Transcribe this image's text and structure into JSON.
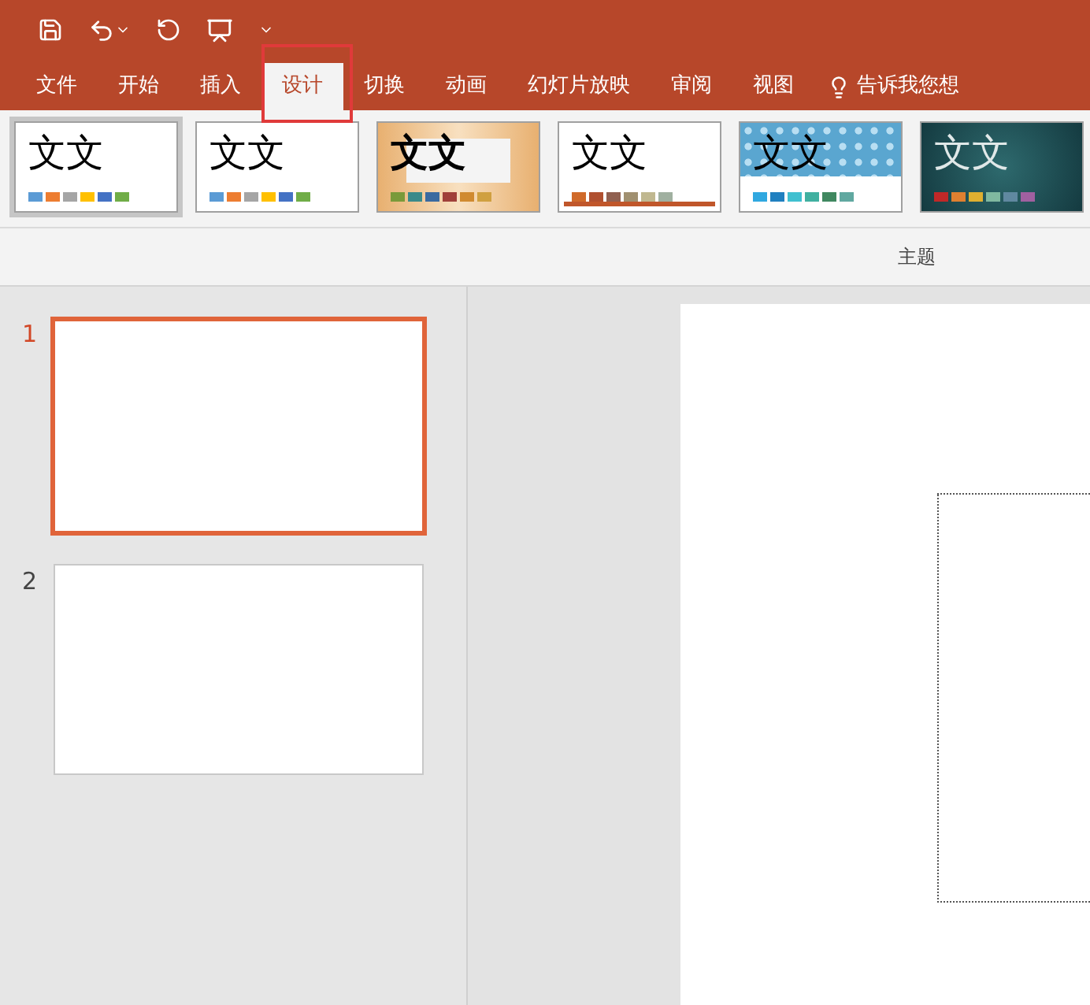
{
  "tabs": [
    {
      "label": "文件",
      "selected": false
    },
    {
      "label": "开始",
      "selected": false
    },
    {
      "label": "插入",
      "selected": false
    },
    {
      "label": "设计",
      "selected": true
    },
    {
      "label": "切换",
      "selected": false
    },
    {
      "label": "动画",
      "selected": false
    },
    {
      "label": "幻灯片放映",
      "selected": false
    },
    {
      "label": "审阅",
      "selected": false
    },
    {
      "label": "视图",
      "selected": false
    }
  ],
  "tell_me": "告诉我您想",
  "themes": [
    {
      "kind": "plain",
      "sample": "文文",
      "selected": true,
      "swatches": [
        {
          "color": "#5b9bd5"
        },
        {
          "color": "#ed7d31"
        },
        {
          "color": "#a5a5a5"
        },
        {
          "color": "#ffc000"
        },
        {
          "color": "#4472c4"
        },
        {
          "color": "#70ad47"
        }
      ]
    },
    {
      "kind": "plain",
      "sample": "文文",
      "selected": false,
      "swatches": [
        {
          "color": "#5b9bd5"
        },
        {
          "color": "#ed7d31"
        },
        {
          "color": "#a5a5a5"
        },
        {
          "color": "#ffc000"
        },
        {
          "color": "#4472c4"
        },
        {
          "color": "#70ad47"
        }
      ]
    },
    {
      "kind": "wood",
      "sample": "文文",
      "selected": false,
      "swatches": [
        {
          "color": "#7a9a3a"
        },
        {
          "color": "#3a8a8a"
        },
        {
          "color": "#3a6aa0"
        },
        {
          "color": "#a0403a"
        },
        {
          "color": "#d08a30"
        },
        {
          "color": "#d0a040"
        }
      ]
    },
    {
      "kind": "line",
      "sample": "文文",
      "selected": false,
      "swatches": [
        {
          "color": "#d06a2a"
        },
        {
          "color": "#b05030"
        },
        {
          "color": "#906050"
        },
        {
          "color": "#a09070"
        },
        {
          "color": "#c0b890"
        },
        {
          "color": "#a0b0a0"
        }
      ]
    },
    {
      "kind": "pattern",
      "sample": "文文",
      "selected": false,
      "swatches": [
        {
          "color": "#30a8e0"
        },
        {
          "color": "#2080c0"
        },
        {
          "color": "#40c0d0"
        },
        {
          "color": "#40b0a0"
        },
        {
          "color": "#408860"
        },
        {
          "color": "#60a8a0"
        }
      ]
    },
    {
      "kind": "dark",
      "sample": "文文",
      "selected": false,
      "swatches": [
        {
          "color": "#c02828"
        },
        {
          "color": "#e08030"
        },
        {
          "color": "#e0b030"
        },
        {
          "color": "#80b8a0"
        },
        {
          "color": "#6088a0"
        },
        {
          "color": "#a060a0"
        }
      ]
    }
  ],
  "group_label": "主题",
  "slides": [
    {
      "number": "1",
      "selected": true
    },
    {
      "number": "2",
      "selected": false
    }
  ]
}
